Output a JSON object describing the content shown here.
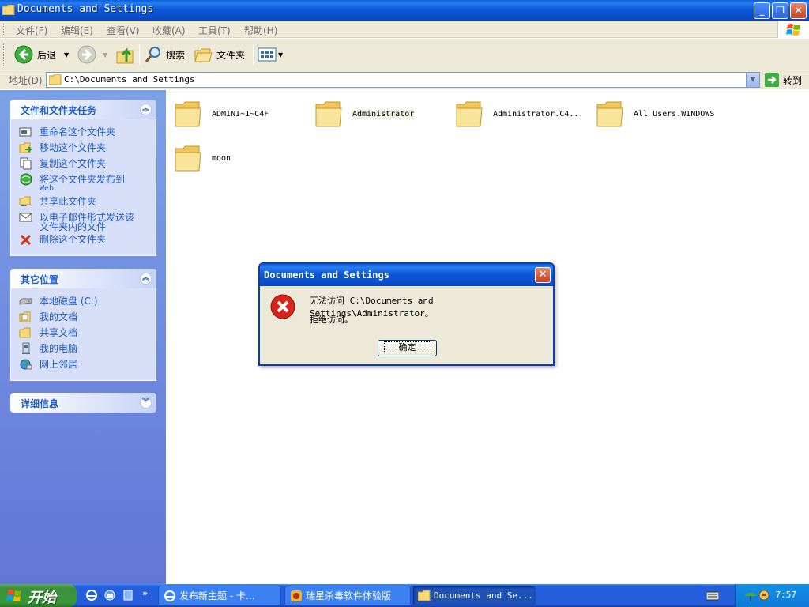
{
  "window": {
    "title": "Documents and Settings",
    "buttons": {
      "minimize": "_",
      "restore": "❐",
      "close": "✕"
    }
  },
  "menu": [
    "文件(F)",
    "编辑(E)",
    "查看(V)",
    "收藏(A)",
    "工具(T)",
    "帮助(H)"
  ],
  "toolbar": {
    "back": "后退",
    "search": "搜索",
    "folders": "文件夹"
  },
  "address": {
    "label": "地址(D)",
    "value": "C:\\Documents and Settings",
    "go": "转到"
  },
  "left_panel": {
    "tasks": {
      "title": "文件和文件夹任务",
      "items": [
        {
          "label": "重命名这个文件夹",
          "icon": "rename-icon"
        },
        {
          "label": "移动这个文件夹",
          "icon": "move-icon"
        },
        {
          "label": "复制这个文件夹",
          "icon": "copy-icon"
        },
        {
          "label": "将这个文件夹发布到",
          "label2": "Web",
          "icon": "publish-web-icon"
        },
        {
          "label": "共享此文件夹",
          "icon": "share-icon"
        },
        {
          "label": "以电子邮件形式发送该",
          "label2": "文件夹内的文件",
          "icon": "email-icon"
        },
        {
          "label": "删除这个文件夹",
          "icon": "delete-icon"
        }
      ]
    },
    "places": {
      "title": "其它位置",
      "items": [
        {
          "label": "本地磁盘 (C:)",
          "icon": "local-disk-icon"
        },
        {
          "label": "我的文档",
          "icon": "my-documents-icon"
        },
        {
          "label": "共享文档",
          "icon": "shared-documents-icon"
        },
        {
          "label": "我的电脑",
          "icon": "my-computer-icon"
        },
        {
          "label": "网上邻居",
          "icon": "network-places-icon"
        }
      ]
    },
    "details": {
      "title": "详细信息"
    }
  },
  "folders": [
    {
      "name": "ADMINI~1~C4F"
    },
    {
      "name": "Administrator"
    },
    {
      "name": "Administrator.C4..."
    },
    {
      "name": "All Users.WINDOWS"
    },
    {
      "name": "moon"
    }
  ],
  "dialog": {
    "title": "Documents and Settings",
    "message_line1": "无法访问 C:\\Documents and Settings\\Administrator。",
    "message_line2": "拒绝访问。",
    "ok": "确定"
  },
  "taskbar": {
    "start": "开始",
    "tasks": [
      {
        "label": "发布新主题 - 卡..."
      },
      {
        "label": "瑞星杀毒软件体验版"
      },
      {
        "label": "Documents and Se..."
      }
    ],
    "clock": "7:57",
    "overflow": "»"
  }
}
